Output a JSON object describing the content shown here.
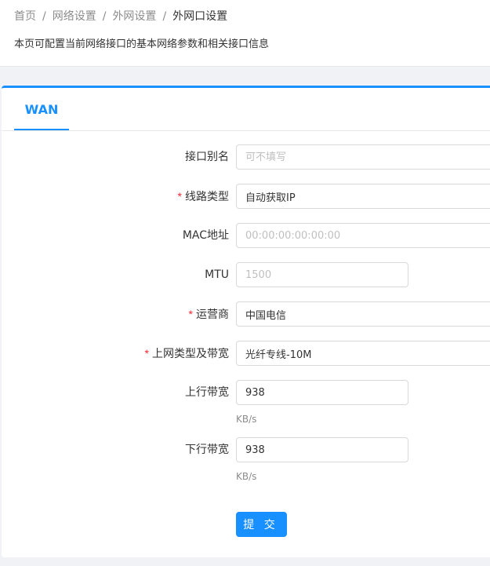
{
  "breadcrumb": {
    "items": [
      "首页",
      "网络设置",
      "外网设置",
      "外网口设置"
    ],
    "separator": "/"
  },
  "page_description": "本页可配置当前网络接口的基本网络参数和相关接口信息",
  "tabs": [
    {
      "label": "WAN",
      "active": true
    }
  ],
  "form": {
    "alias": {
      "label": "接口别名",
      "required": false,
      "value": "",
      "placeholder": "可不填写"
    },
    "line_type": {
      "label": "线路类型",
      "required": true,
      "value": "自动获取IP"
    },
    "mac": {
      "label": "MAC地址",
      "required": false,
      "value": "",
      "placeholder": "00:00:00:00:00:00"
    },
    "mtu": {
      "label": "MTU",
      "required": false,
      "value": "",
      "placeholder": "1500"
    },
    "isp": {
      "label": "运营商",
      "required": true,
      "value": "中国电信"
    },
    "bandwidth_type": {
      "label": "上网类型及带宽",
      "required": true,
      "value": "光纤专线-10M"
    },
    "upload": {
      "label": "上行带宽",
      "required": false,
      "value": "938",
      "unit": "KB/s"
    },
    "download": {
      "label": "下行带宽",
      "required": false,
      "value": "938",
      "unit": "KB/s"
    },
    "required_mark": "*",
    "submit_label": "提 交"
  },
  "colors": {
    "accent": "#1890ff",
    "required": "#f5222d",
    "background": "#f0f2f5"
  }
}
